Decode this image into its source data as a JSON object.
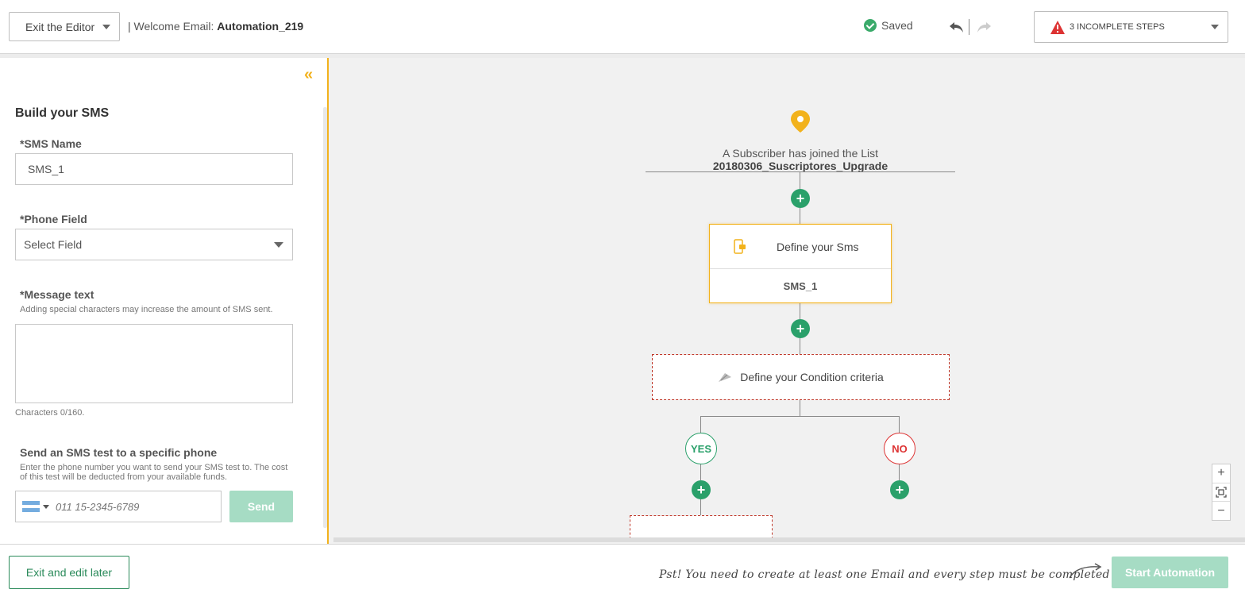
{
  "header": {
    "exit_editor": "Exit the Editor",
    "title_prefix": "| Welcome Email:",
    "title_name": "Automation_219",
    "saved": "Saved",
    "incomplete": "3 INCOMPLETE STEPS"
  },
  "panel": {
    "heading": "Build your SMS",
    "sms_name_label": "*SMS Name",
    "sms_name_value": "SMS_1",
    "phone_field_label": "*Phone Field",
    "phone_field_value": "Select Field",
    "message_label": "*Message text",
    "message_hint": "Adding special characters may increase the amount of SMS sent.",
    "char_count": "Characters 0/160.",
    "test_heading": "Send an SMS test to a specific phone",
    "test_hint": "Enter the phone number you want to send your SMS test to. The cost of this test will be deducted from your available funds.",
    "phone_placeholder": "011 15-2345-6789",
    "send": "Send"
  },
  "canvas": {
    "trigger_prefix": "A Subscriber has joined the List",
    "trigger_list": "20180306_Suscriptores_Upgrade",
    "sms_card_title": "Define your Sms",
    "sms_card_name": "SMS_1",
    "condition": "Define your Condition criteria",
    "yes": "YES",
    "no": "NO",
    "plus": "+",
    "zoom_in": "+",
    "zoom_out": "−"
  },
  "footer": {
    "exit_later": "Exit and edit later",
    "pst": "Pst! You need to create at least one Email and every step must be completed",
    "start": "Start Automation"
  },
  "colors": {
    "accent": "#f2b21c",
    "green": "#2aa06a",
    "danger": "#d33"
  }
}
